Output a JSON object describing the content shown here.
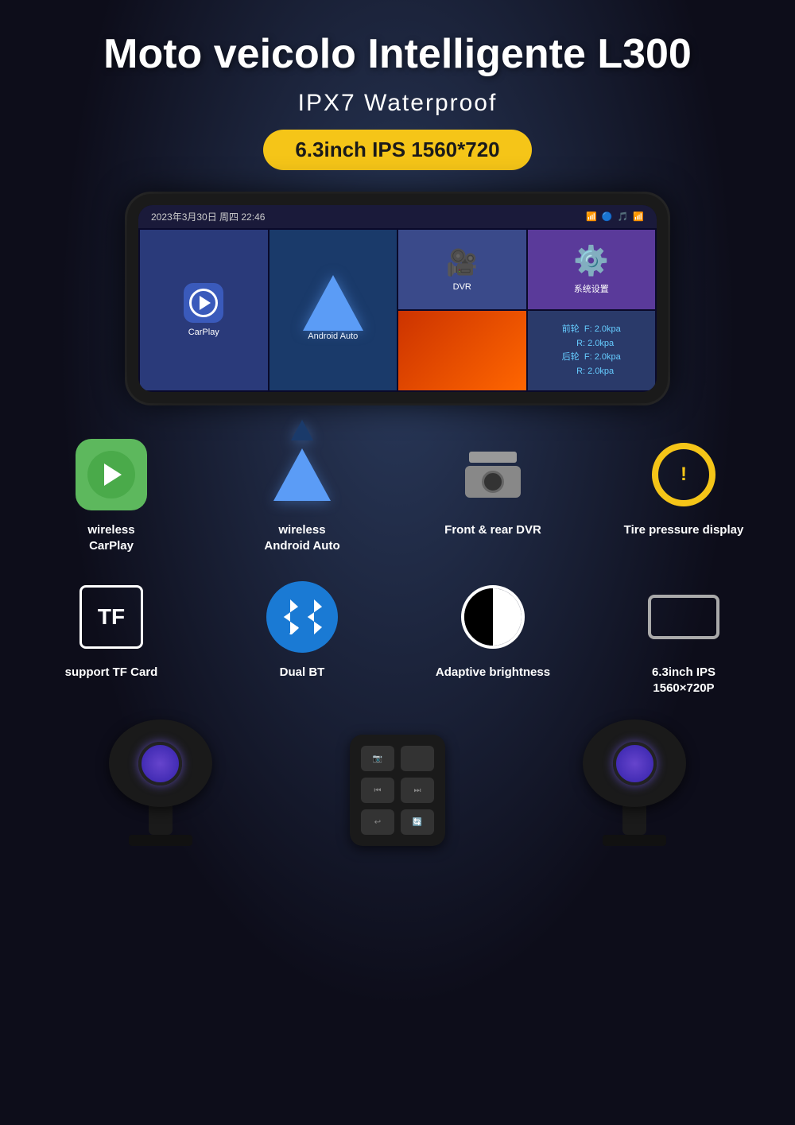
{
  "page": {
    "title": "Moto veicolo Intelligente L300",
    "subtitle": "IPX7 Waterproof",
    "badge": "6.3inch IPS  1560*720",
    "screen": {
      "datetime": "2023年3月30日 周四 22:46",
      "tiles": [
        {
          "id": "carplay",
          "label": "CarPlay"
        },
        {
          "id": "android",
          "label": "Android Auto"
        },
        {
          "id": "dvr",
          "label": "DVR"
        },
        {
          "id": "settings",
          "label": "系统设置"
        },
        {
          "id": "moto",
          "label": ""
        },
        {
          "id": "tpms",
          "label": "前轮 F: 2.0kpa\nR: 2.0kpa\n后轮 F: 2.0kpa\nR: 2.0kpa"
        }
      ]
    },
    "features_row1": [
      {
        "id": "carplay",
        "label": "wireless\nCarPlay"
      },
      {
        "id": "android_auto",
        "label": "wireless\nAndroid Auto"
      },
      {
        "id": "dvr",
        "label": "Front & rear DVR"
      },
      {
        "id": "tire",
        "label": "Tire pressure display"
      }
    ],
    "features_row2": [
      {
        "id": "tf",
        "label": "support TF Card"
      },
      {
        "id": "bt",
        "label": "Dual BT"
      },
      {
        "id": "brightness",
        "label": "Adaptive brightness"
      },
      {
        "id": "screen",
        "label": "6.3inch IPS\n1560×720P"
      }
    ]
  }
}
